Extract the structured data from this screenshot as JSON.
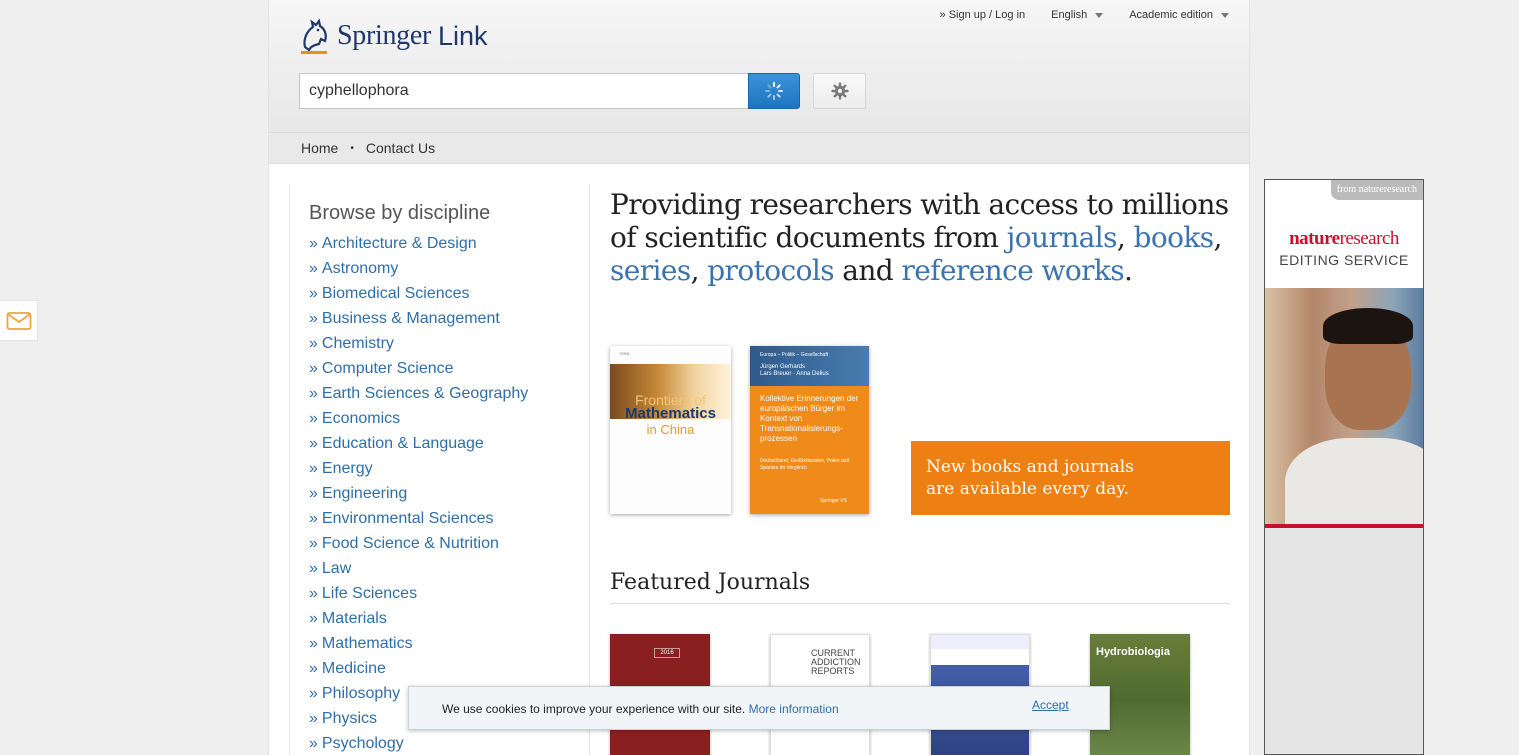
{
  "header": {
    "logo_springer": "Springer",
    "logo_link": "Link",
    "signup_login": "» Sign up / Log in",
    "language": "English",
    "edition": "Academic edition"
  },
  "search": {
    "value": "cyphellophora"
  },
  "nav": {
    "home": "Home",
    "separator": "•",
    "contact": "Contact Us"
  },
  "sidebar": {
    "title": "Browse by discipline",
    "raquo": "»",
    "disciplines": [
      "Architecture & Design",
      "Astronomy",
      "Biomedical Sciences",
      "Business & Management",
      "Chemistry",
      "Computer Science",
      "Earth Sciences & Geography",
      "Economics",
      "Education & Language",
      "Energy",
      "Engineering",
      "Environmental Sciences",
      "Food Science & Nutrition",
      "Law",
      "Life Sciences",
      "Materials",
      "Mathematics",
      "Medicine",
      "Philosophy",
      "Physics",
      "Psychology"
    ]
  },
  "hero": {
    "text_before": "Providing researchers with access to millions of scientific documents from ",
    "journals": "journals",
    "comma1": ", ",
    "books": "books",
    "comma2": ", ",
    "series": "series",
    "comma3": ", ",
    "protocols": "protocols",
    "and": " and ",
    "reference_works": "reference works",
    "period": "."
  },
  "covers": {
    "fom_title_1": "Frontiers of",
    "fom_title_2": "Mathematics",
    "fom_title_3": "in China",
    "ke_series": "Europa – Politik – Gesellschaft",
    "ke_authors": "Jürgen Gerhards\nLars Breuer · Anna Delius",
    "ke_title": "Kollektive Erinnerungen der europäischen Bürger im Kontext von Transnationalisierungs-prozessen",
    "ke_subtitle": "Deutschland, Großbritannien, Polen und Spanien im Vergleich",
    "ke_publisher": "Springer VS"
  },
  "promo": {
    "line1": "New books and journals",
    "line2": "are available every day."
  },
  "featured": {
    "title": "Featured Journals",
    "j1_year": "2016",
    "j2_title": "CURRENT\nADDICTION\nREPORTS",
    "j4_title": "Hydrobiologia"
  },
  "cookie": {
    "message": "We use cookies to improve your experience with our site.",
    "more": "More information",
    "accept": "Accept"
  },
  "ad": {
    "from": "from natureresearch",
    "nature": "nature",
    "research": "research",
    "editing": "EDITING SERVICE"
  },
  "colors": {
    "link_blue": "#2f6ea8",
    "hero_blue": "#3b73af",
    "promo_orange": "#ee8013",
    "search_blue": "#1e74c0",
    "nature_red": "#c8102e"
  }
}
